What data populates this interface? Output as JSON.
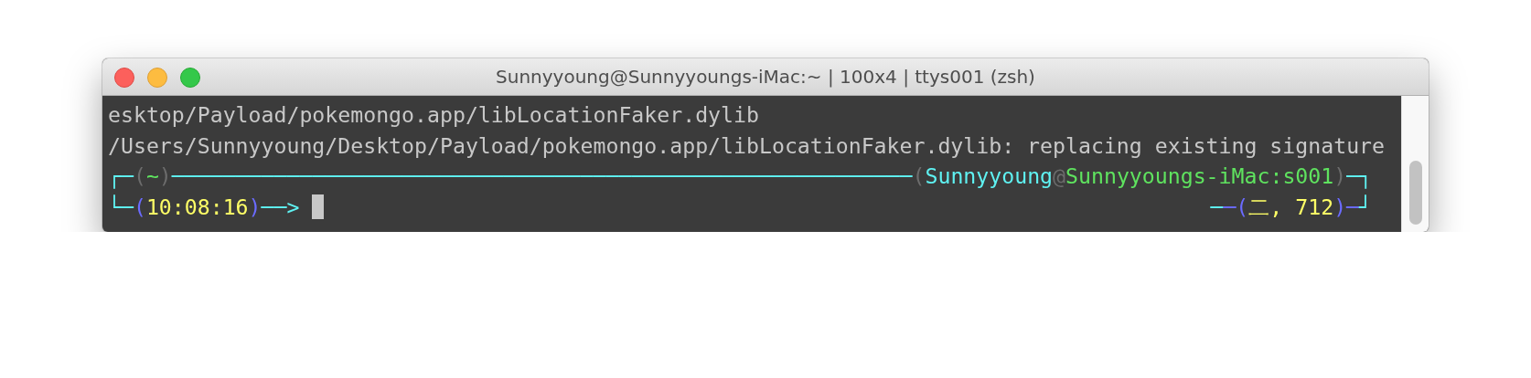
{
  "window": {
    "title": "Sunnyyoung@Sunnyyoungs-iMac:~ | 100x4 | ttys001 (zsh)"
  },
  "terminal": {
    "output_lines": [
      "esktop/Payload/pokemongo.app/libLocationFaker.dylib",
      "/Users/Sunnyyoung/Desktop/Payload/pokemongo.app/libLocationFaker.dylib: replacing existing signature"
    ],
    "prompt_top": [
      {
        "text": "┌─",
        "color": "#5ff2f2"
      },
      {
        "text": "(",
        "color": "#6c6c6c"
      },
      {
        "text": "~",
        "color": "#5fe35f"
      },
      {
        "text": ")",
        "color": "#6c6c6c"
      },
      {
        "text": "──────────────────────────────────────────────────────────",
        "color": "#5ff2f2"
      },
      {
        "text": "(",
        "color": "#6c6c6c"
      },
      {
        "text": "Sunnyyoung",
        "color": "#5ff2f2"
      },
      {
        "text": "@",
        "color": "#6c6c6c"
      },
      {
        "text": "Sunnyyoungs-iMac:s001",
        "color": "#5fe35f"
      },
      {
        "text": ")",
        "color": "#6c6c6c"
      },
      {
        "text": "─┐",
        "color": "#5ff2f2"
      }
    ],
    "prompt_bottom": [
      {
        "text": "└─",
        "color": "#5ff2f2"
      },
      {
        "text": "(",
        "color": "#6b6bff"
      },
      {
        "text": "10:08:16",
        "color": "#ffff66"
      },
      {
        "text": ")",
        "color": "#6b6bff"
      },
      {
        "text": "──>",
        "color": "#5ff2f2"
      }
    ],
    "prompt_right": [
      {
        "text": "─",
        "color": "#5ff2f2"
      },
      {
        "text": "─(",
        "color": "#6b6bff"
      },
      {
        "text": "二, 712",
        "color": "#ffff66"
      },
      {
        "text": ")─",
        "color": "#6b6bff"
      },
      {
        "text": "┘",
        "color": "#5ff2f2"
      }
    ]
  }
}
